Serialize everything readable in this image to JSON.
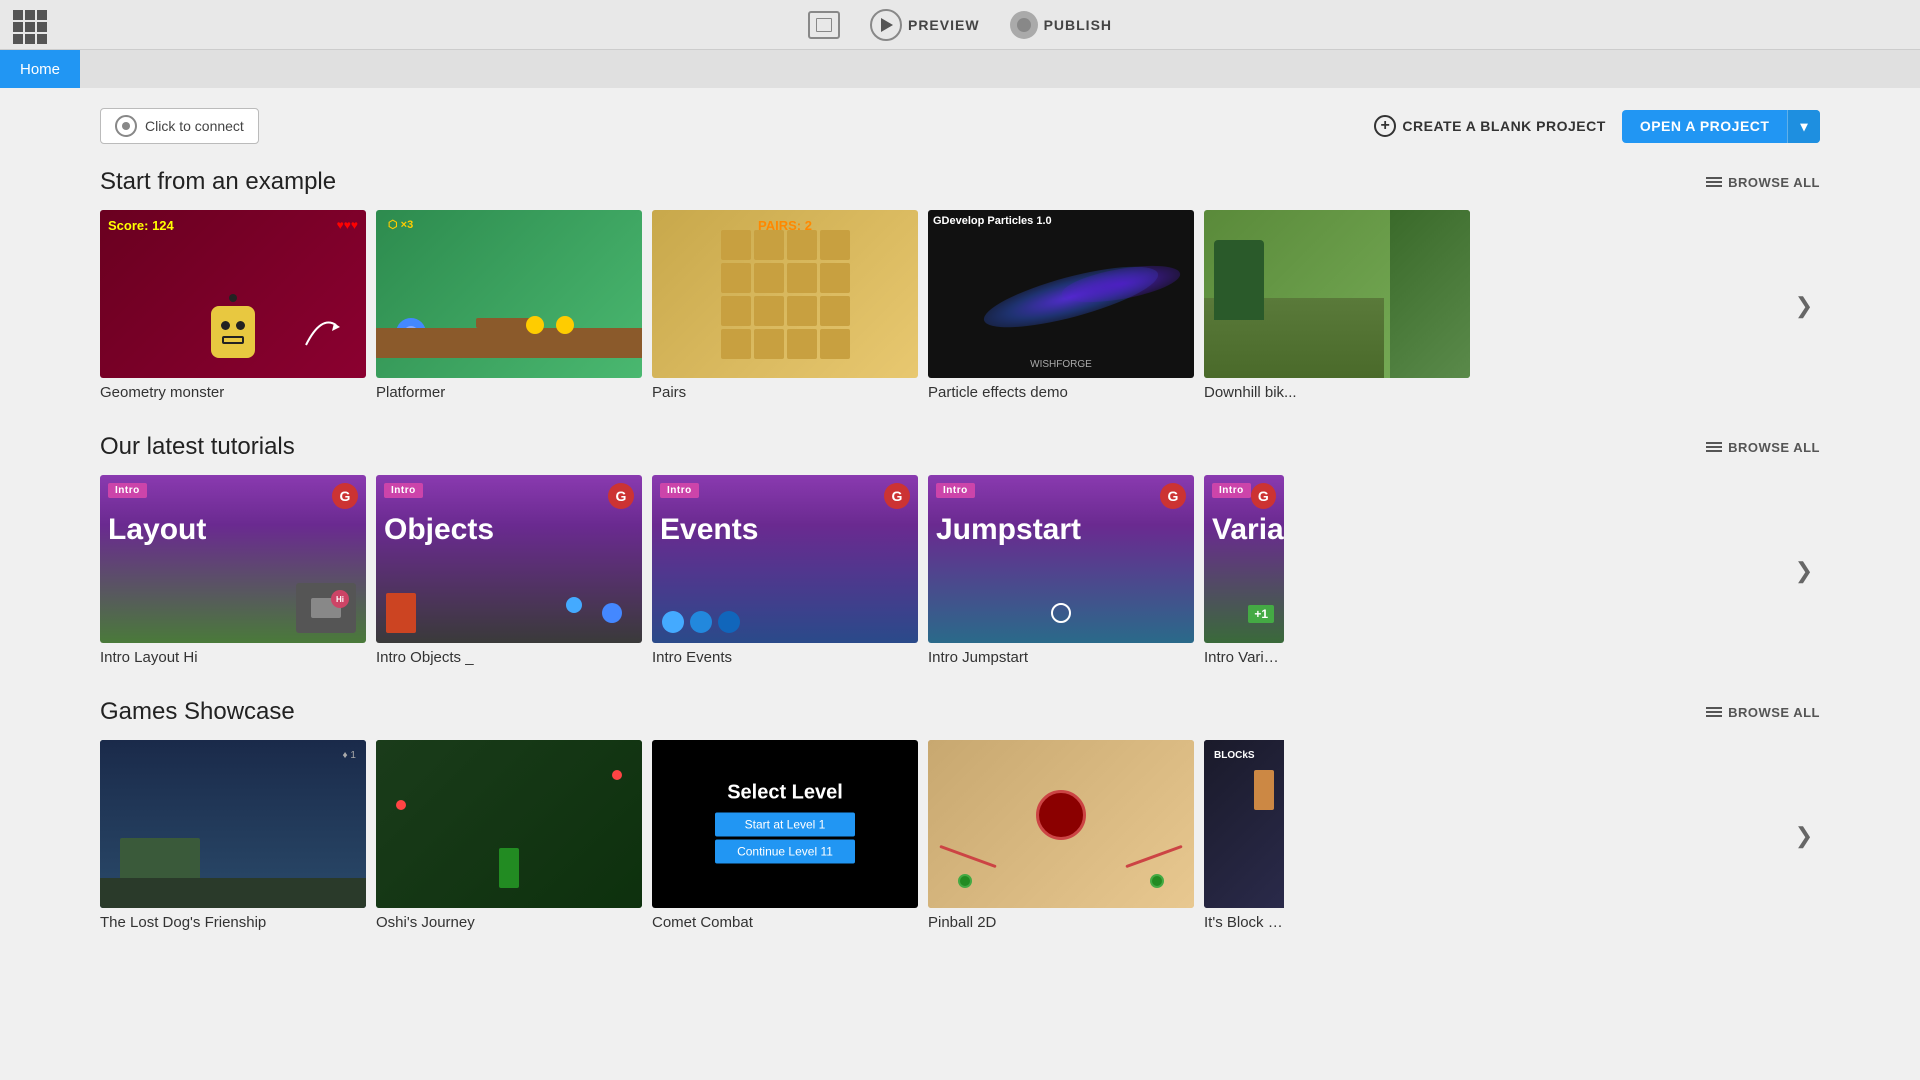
{
  "topbar": {
    "preview_label": "PREVIEW",
    "publish_label": "PUBLISH"
  },
  "nav": {
    "home_label": "Home"
  },
  "actions": {
    "connect_label": "Click to connect",
    "create_blank_label": "CREATE A BLANK PROJECT",
    "open_project_label": "OPEN A PROJECT"
  },
  "sections": {
    "examples": {
      "title": "Start from an example",
      "browse_all": "BROWSE ALL",
      "cards": [
        {
          "label": "Geometry monster",
          "thumb": "geometry"
        },
        {
          "label": "Platformer",
          "thumb": "platformer"
        },
        {
          "label": "Pairs",
          "thumb": "pairs"
        },
        {
          "label": "Particle effects demo",
          "thumb": "particle"
        },
        {
          "label": "Downhill bik...",
          "thumb": "downhill"
        }
      ]
    },
    "tutorials": {
      "title": "Our latest tutorials",
      "browse_all": "BROWSE ALL",
      "cards": [
        {
          "label": "Intro Layout",
          "tag": "Intro",
          "title": "Layout",
          "thumb": "layout"
        },
        {
          "label": "Intro Objects",
          "tag": "Intro",
          "title": "Objects",
          "thumb": "objects"
        },
        {
          "label": "Intro Events",
          "tag": "Intro",
          "title": "Events",
          "thumb": "events"
        },
        {
          "label": "Intro Jumpstart",
          "tag": "Intro",
          "title": "Jumpstart",
          "thumb": "jumpstart"
        },
        {
          "label": "Intro Variab...",
          "tag": "Intro",
          "title": "Variab...",
          "thumb": "variables"
        }
      ]
    },
    "showcase": {
      "title": "Games Showcase",
      "browse_all": "BROWSE ALL",
      "cards": [
        {
          "label": "The Lost Dog's Frienship",
          "thumb": "dog"
        },
        {
          "label": "Oshi's Journey",
          "thumb": "oshi"
        },
        {
          "label": "Comet Combat",
          "thumb": "comet"
        },
        {
          "label": "Pinball 2D",
          "thumb": "pinball"
        },
        {
          "label": "It's Block Ma...",
          "thumb": "blocks"
        }
      ]
    }
  }
}
